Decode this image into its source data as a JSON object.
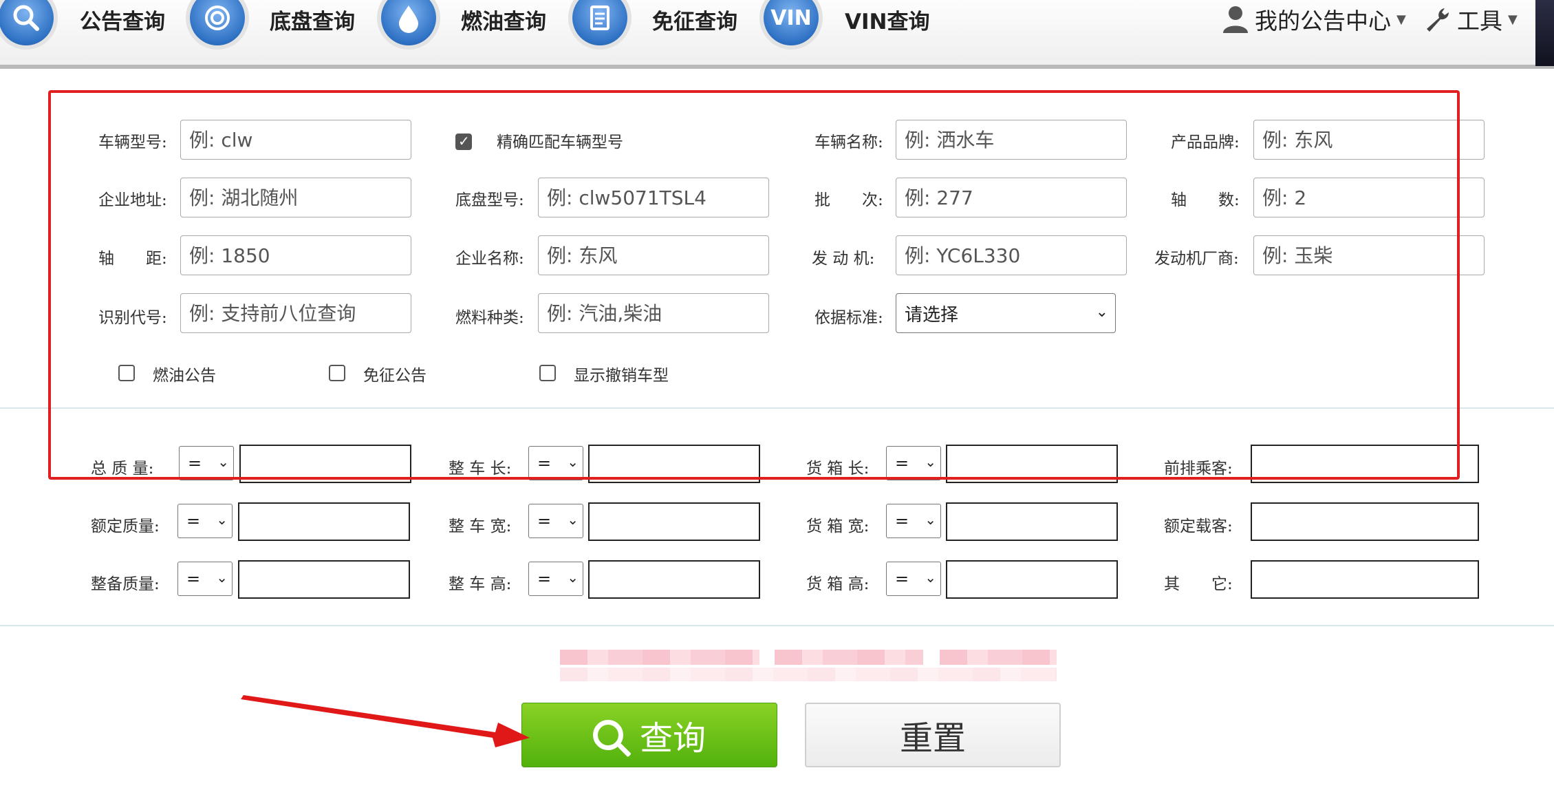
{
  "nav": {
    "items": [
      {
        "label": "公告查询",
        "icon": "search-icon"
      },
      {
        "label": "底盘查询",
        "icon": "chassis-icon"
      },
      {
        "label": "燃油查询",
        "icon": "fuel-drop-icon"
      },
      {
        "label": "免征查询",
        "icon": "document-icon"
      },
      {
        "label": "VIN查询",
        "icon": "vin-icon",
        "badge": "VIN"
      }
    ],
    "user_center": "我的公告中心",
    "tools": "工具"
  },
  "form": {
    "vehicle_model": {
      "label": "车辆型号:",
      "placeholder": "例: clw"
    },
    "exact_match": {
      "label": "精确匹配车辆型号",
      "checked": true
    },
    "vehicle_name": {
      "label": "车辆名称:",
      "placeholder": "例: 洒水车"
    },
    "brand": {
      "label": "产品品牌:",
      "placeholder": "例: 东风"
    },
    "company_address": {
      "label": "企业地址:",
      "placeholder": "例: 湖北随州"
    },
    "chassis_model": {
      "label": "底盘型号:",
      "placeholder": "例: clw5071TSL4"
    },
    "batch": {
      "label": "批　　次:",
      "placeholder": "例: 277"
    },
    "axle_count": {
      "label": "轴　　数:",
      "placeholder": "例: 2"
    },
    "wheelbase": {
      "label": "轴　　距:",
      "placeholder": "例: 1850"
    },
    "company_name": {
      "label": "企业名称:",
      "placeholder": "例: 东风"
    },
    "engine": {
      "label": "发 动 机:",
      "placeholder": "例: YC6L330"
    },
    "engine_maker": {
      "label": "发动机厂商:",
      "placeholder": "例: 玉柴"
    },
    "vin_code": {
      "label": "识别代号:",
      "placeholder": "例: 支持前八位查询"
    },
    "fuel_type": {
      "label": "燃料种类:",
      "placeholder": "例: 汽油,柴油"
    },
    "standard": {
      "label": "依据标准:",
      "value": "请选择"
    },
    "checks": [
      {
        "label": "燃油公告",
        "checked": false
      },
      {
        "label": "免征公告",
        "checked": false
      },
      {
        "label": "显示撤销车型",
        "checked": false
      }
    ]
  },
  "dims": {
    "operator": "=",
    "rows": [
      [
        "总 质 量:",
        "整 车 长:",
        "货 箱 长:",
        "前排乘客:"
      ],
      [
        "额定质量:",
        "整 车 宽:",
        "货 箱 宽:",
        "额定载客:"
      ],
      [
        "整备质量:",
        "整 车 高:",
        "货 箱 高:",
        "其　　它:"
      ]
    ]
  },
  "buttons": {
    "search": "查询",
    "reset": "重置"
  }
}
